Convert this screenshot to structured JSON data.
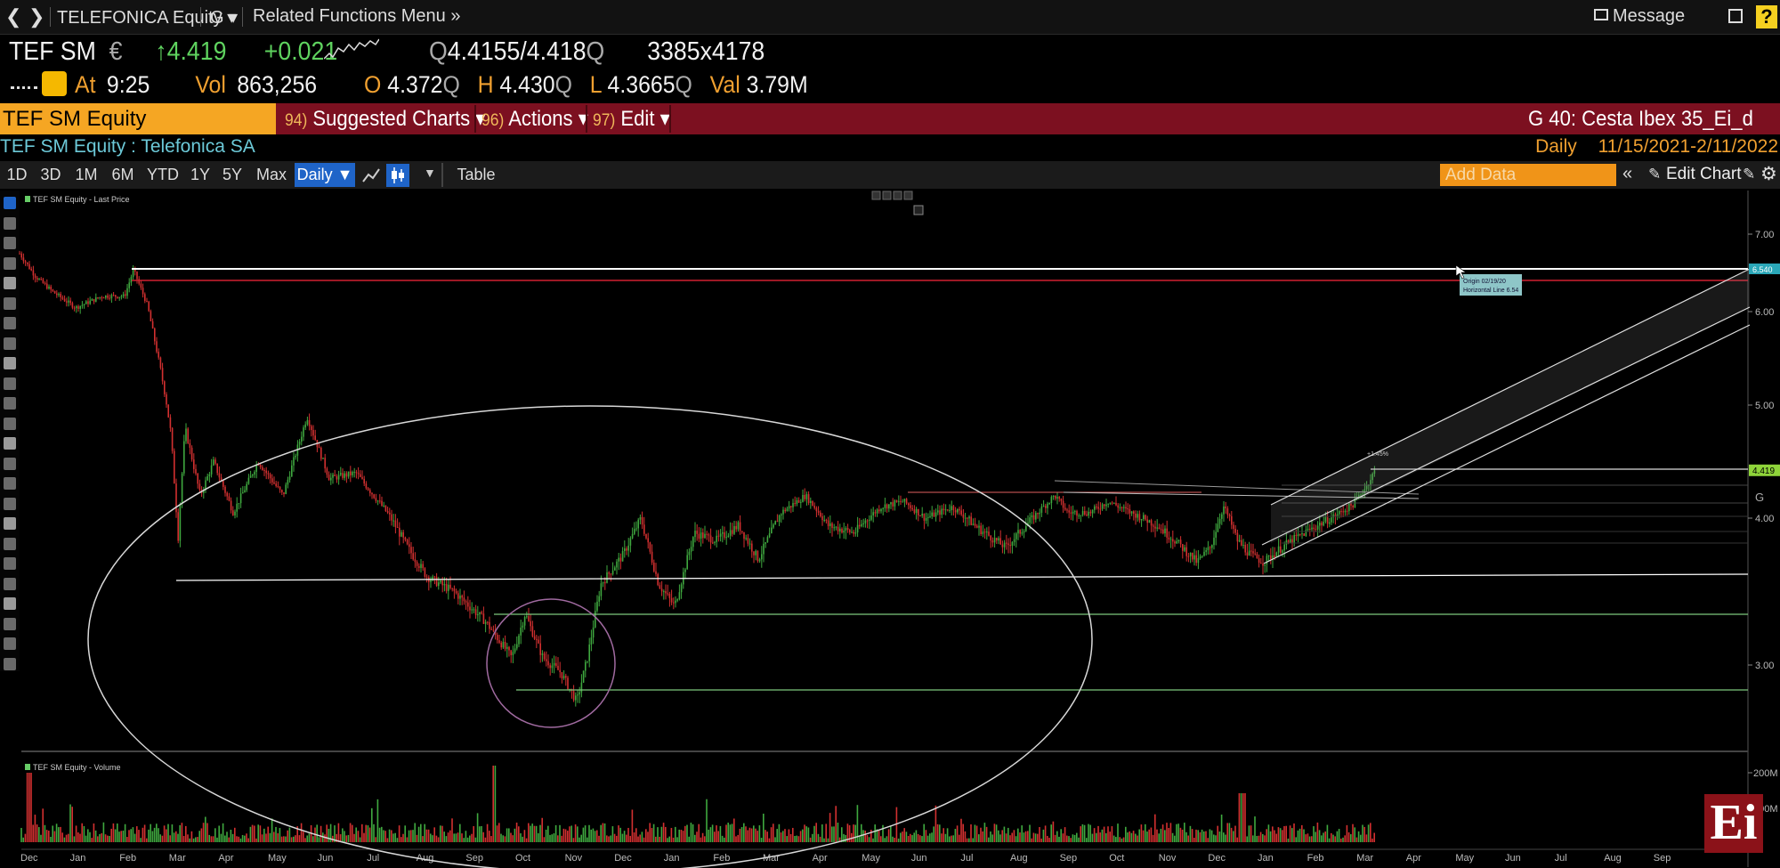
{
  "titlebar": {
    "back": "❮",
    "forward": "❯",
    "security": "TELEFONICA Equity ▾",
    "function": "G ▾",
    "related": "Related Functions Menu »",
    "message": "Message",
    "help": "?"
  },
  "quote": {
    "ticker": "TEF SM",
    "currency": "€",
    "last": "↑4.419",
    "change": "+0.021",
    "bid": "4.4155",
    "ask": "4.418",
    "bid_size": "3385",
    "ask_size": "4178",
    "time_label": "At",
    "time": "9:25",
    "vol_label": "Vol",
    "vol": "863,256",
    "open_label": "O",
    "open": "4.372",
    "high_label": "H",
    "high": "4.430",
    "low_label": "L",
    "low": "4.3665",
    "val_label": "Val",
    "val": "3.79M",
    "q_marker": "Q"
  },
  "menubar": {
    "equity_tab": "TEF SM Equity",
    "suggested_num": "94)",
    "suggested": "Suggested Charts ▾",
    "actions_num": "96)",
    "actions": "Actions ▾",
    "edit_num": "97)",
    "edit": "Edit ▾",
    "right_title": "G 40: Cesta Ibex 35_Ei_d"
  },
  "subheader": {
    "security_line": "TEF SM Equity : Telefonica SA",
    "frequency": "Daily",
    "date_range": "11/15/2021-2/11/2022"
  },
  "toolbar": {
    "ranges": [
      "1D",
      "3D",
      "1M",
      "6M",
      "YTD",
      "1Y",
      "5Y",
      "Max"
    ],
    "daily": "Daily ▼",
    "table": "Table",
    "add_data_placeholder": "Add Data",
    "edit_chart": "Edit Chart"
  },
  "chart": {
    "price_panel_label": "TEF SM Equity - Last Price",
    "volume_panel_label": "TEF SM Equity - Volume",
    "price_ticks": [
      "7.00",
      "6.00",
      "5.00",
      "4.00",
      "3.00"
    ],
    "volume_ticks": [
      "200M",
      "100M"
    ],
    "x_labels": [
      "Dec",
      "Jan",
      "Feb",
      "Mar",
      "Apr",
      "May",
      "Jun",
      "Jul",
      "Aug",
      "Sep",
      "Oct",
      "Nov",
      "Dec",
      "Jan",
      "Feb",
      "Mar",
      "Apr",
      "May",
      "Jun",
      "Jul",
      "Aug",
      "Sep",
      "Oct",
      "Nov",
      "Dec",
      "Jan",
      "Feb",
      "Mar",
      "Apr",
      "May",
      "Jun",
      "Jul",
      "Aug",
      "Sep"
    ],
    "last_price_tag": "4.419",
    "resistance_tag": "6.540",
    "tooltip_line1": "Origin 02/19/20",
    "tooltip_line2": "Horizontal Line 6.54",
    "annotation_small": "+1.45%",
    "tab_marker": "G",
    "colors": {
      "up": "#3fa83f",
      "down": "#d23030",
      "ellipse": "#d8d8d8",
      "small_circle": "#a06aa0",
      "resistance": "#ffffff",
      "red_line": "#d02030",
      "green_line": "#7ec87e"
    }
  },
  "logo": "Ei"
}
